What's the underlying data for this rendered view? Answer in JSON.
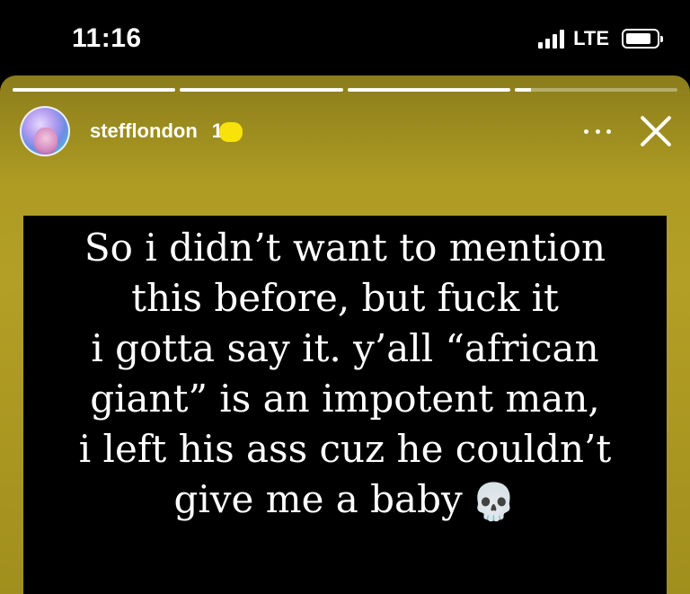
{
  "status_bar": {
    "time": "11:16",
    "network": "LTE",
    "signal_bars": 4,
    "battery_percent": 85
  },
  "story": {
    "progress": [
      1,
      1,
      1,
      0.1
    ],
    "header": {
      "username": "stefflondon",
      "time_ago": "1",
      "more_icon": "more-horizontal-icon",
      "close_icon": "close-icon"
    },
    "text_lines": [
      "So i didn’t want to mention",
      "this before, but fuck it",
      "i gotta say it. y’all “african",
      "giant” is an impotent man,",
      "i left his ass cuz he couldn’t",
      "give me a baby"
    ],
    "emoji": "💀",
    "colors": {
      "background": "#a99821",
      "text_box": "#000000",
      "redaction": "#f8e20a"
    }
  }
}
